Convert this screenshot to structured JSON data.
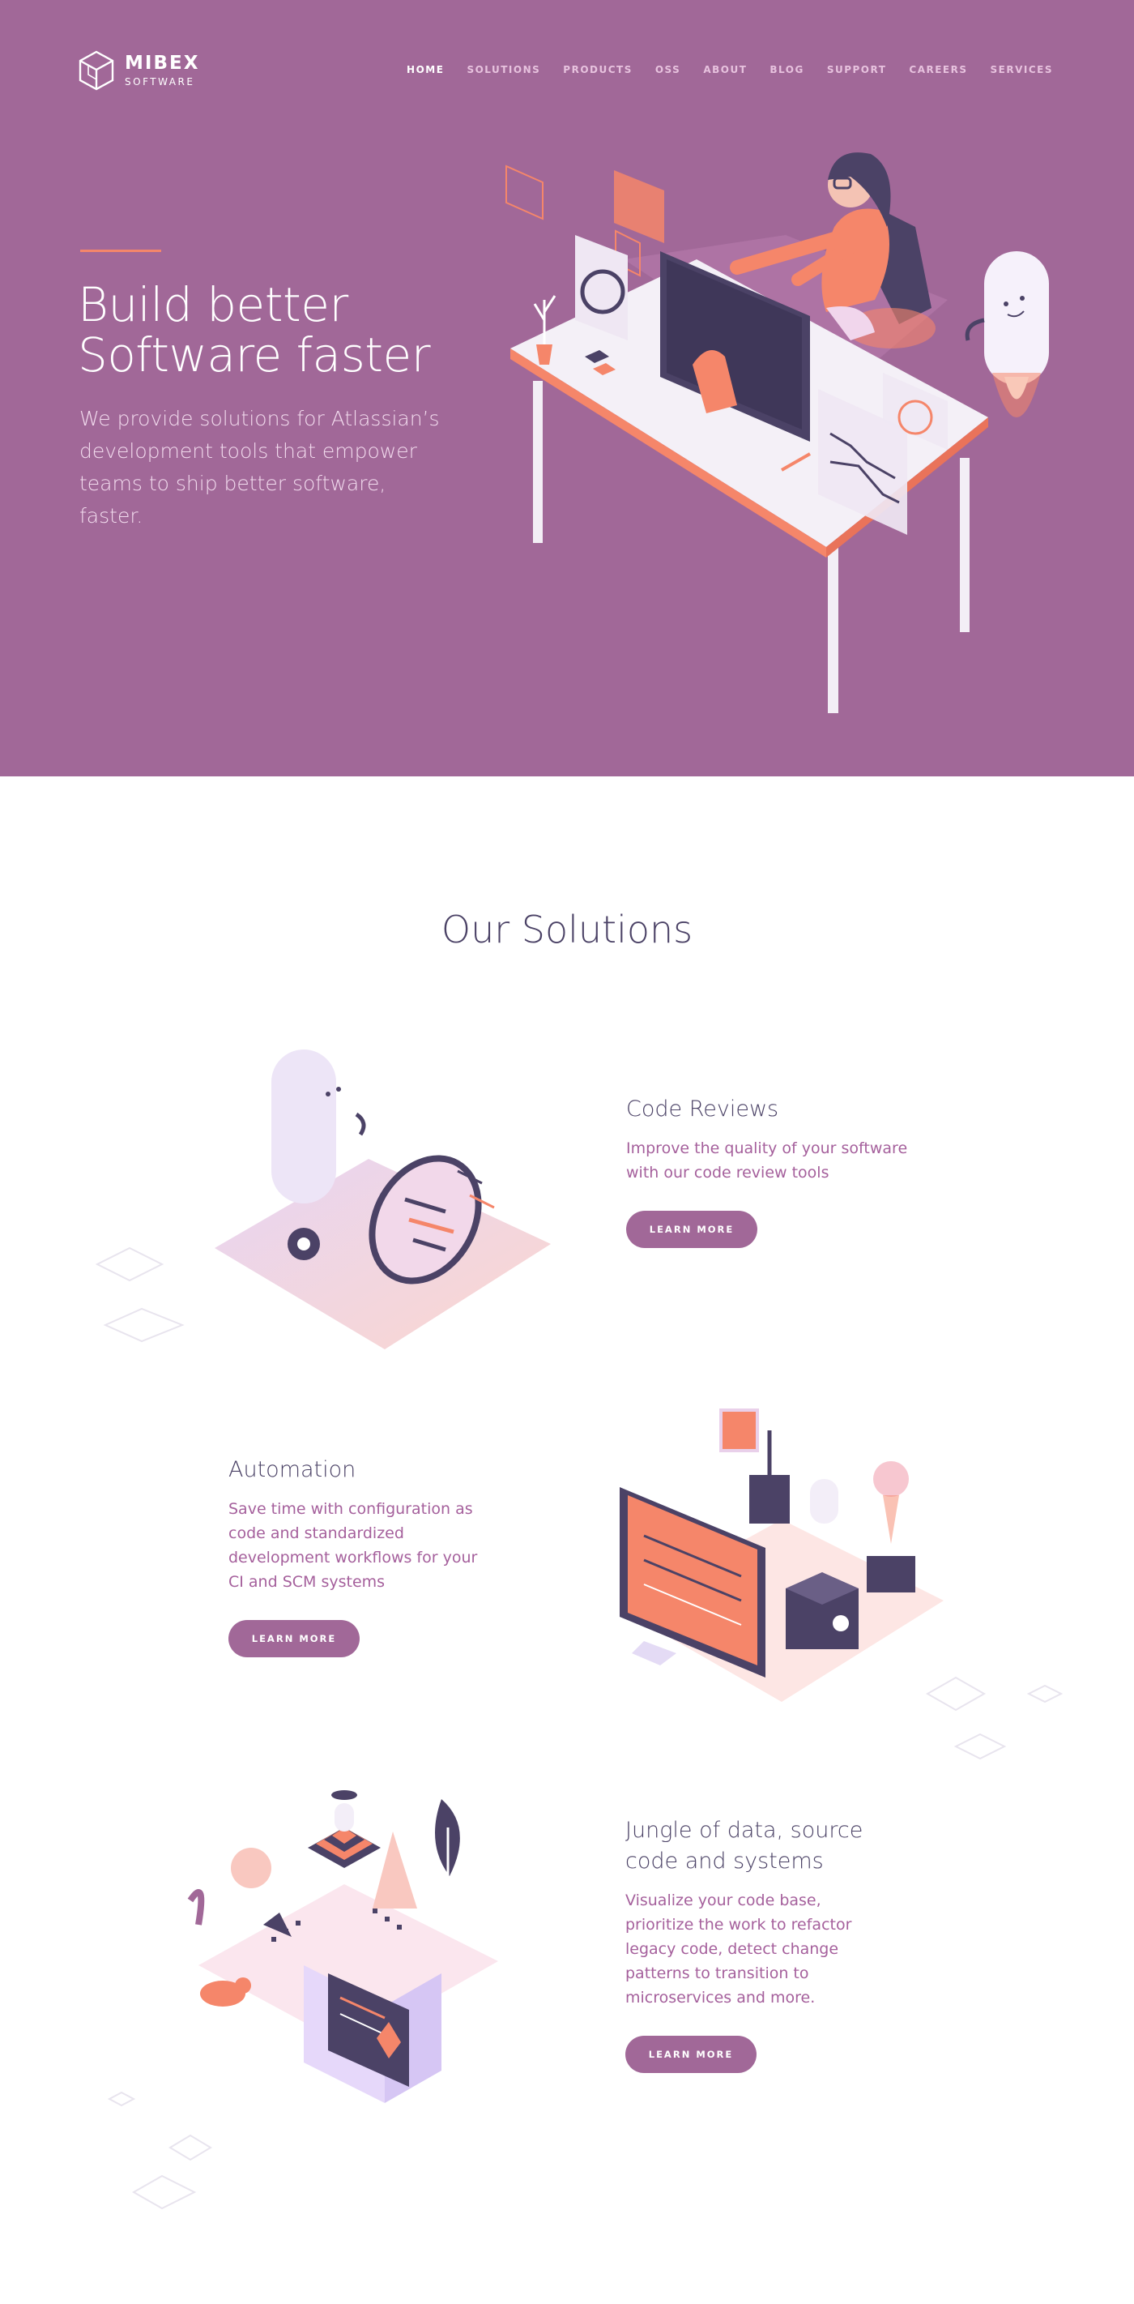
{
  "brand": {
    "name": "MIBEX",
    "sub": "SOFTWARE"
  },
  "nav": {
    "items": [
      {
        "label": "HOME",
        "active": true
      },
      {
        "label": "SOLUTIONS",
        "active": false
      },
      {
        "label": "PRODUCTS",
        "active": false
      },
      {
        "label": "OSS",
        "active": false
      },
      {
        "label": "ABOUT",
        "active": false
      },
      {
        "label": "BLOG",
        "active": false
      },
      {
        "label": "SUPPORT",
        "active": false
      },
      {
        "label": "CAREERS",
        "active": false
      },
      {
        "label": "SERVICES",
        "active": false
      }
    ]
  },
  "hero": {
    "title_line1": "Build better",
    "title_line2": "Software faster",
    "description": "We provide solutions for Atlassian’s development tools that empower teams to ship better software, faster."
  },
  "solutions": {
    "heading": "Our Solutions",
    "items": [
      {
        "title": "Code Reviews",
        "description": "Improve the quality of your software with our code review tools",
        "button": "LEARN MORE"
      },
      {
        "title": "Automation",
        "description": "Save time with configuration as code and standardized development workflows for your CI and SCM systems",
        "button": "LEARN MORE"
      },
      {
        "title": "Jungle of data, source code and systems",
        "description": "Visualize your code base, prioritize the work to refactor legacy code, detect change patterns to transition to microservices and more.",
        "button": "LEARN MORE"
      }
    ]
  },
  "colors": {
    "hero_bg": "#a16898",
    "accent": "#f5866a",
    "dark": "#4b4266",
    "button": "#a16898",
    "link_text": "#a5609c"
  },
  "icons": [
    "cube-logo-icon"
  ]
}
